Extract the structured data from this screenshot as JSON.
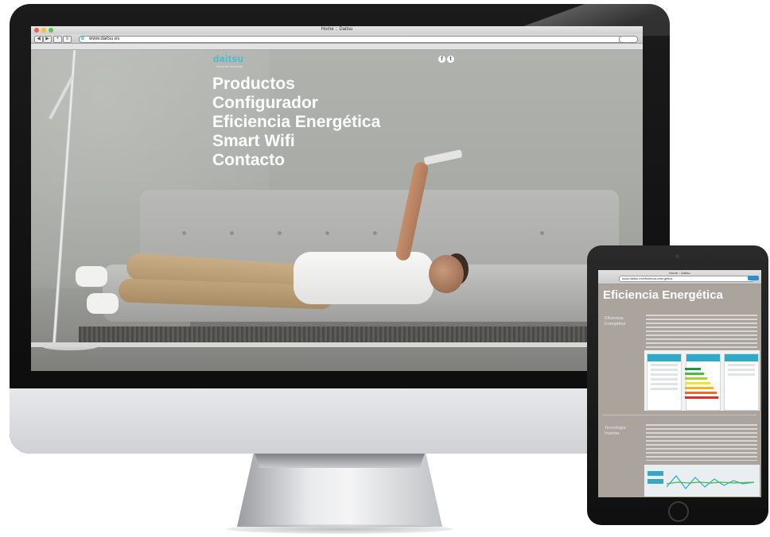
{
  "desktop_browser": {
    "window_title": "Home :: Daitsu",
    "url": "www.daitsu.es",
    "site": {
      "logo_text": "daitsu",
      "logo_tagline": "Alma del bienestar",
      "social": [
        "f",
        "t"
      ],
      "menu": [
        "Productos",
        "Configurador",
        "Eficiencia Energética",
        "Smart Wifi",
        "Contacto"
      ]
    }
  },
  "tablet_browser": {
    "window_title": "Home :: Daitsu",
    "url": "www.daitsu.es/eficiencia-energetica",
    "page_title": "Eficiencia Energética",
    "sections": [
      {
        "label": "Eficiencia Energética"
      },
      {
        "label": "Tecnología Inverter"
      }
    ]
  },
  "colors": {
    "brand_accent": "#3fbcd6",
    "menu_text": "#ffffff"
  }
}
